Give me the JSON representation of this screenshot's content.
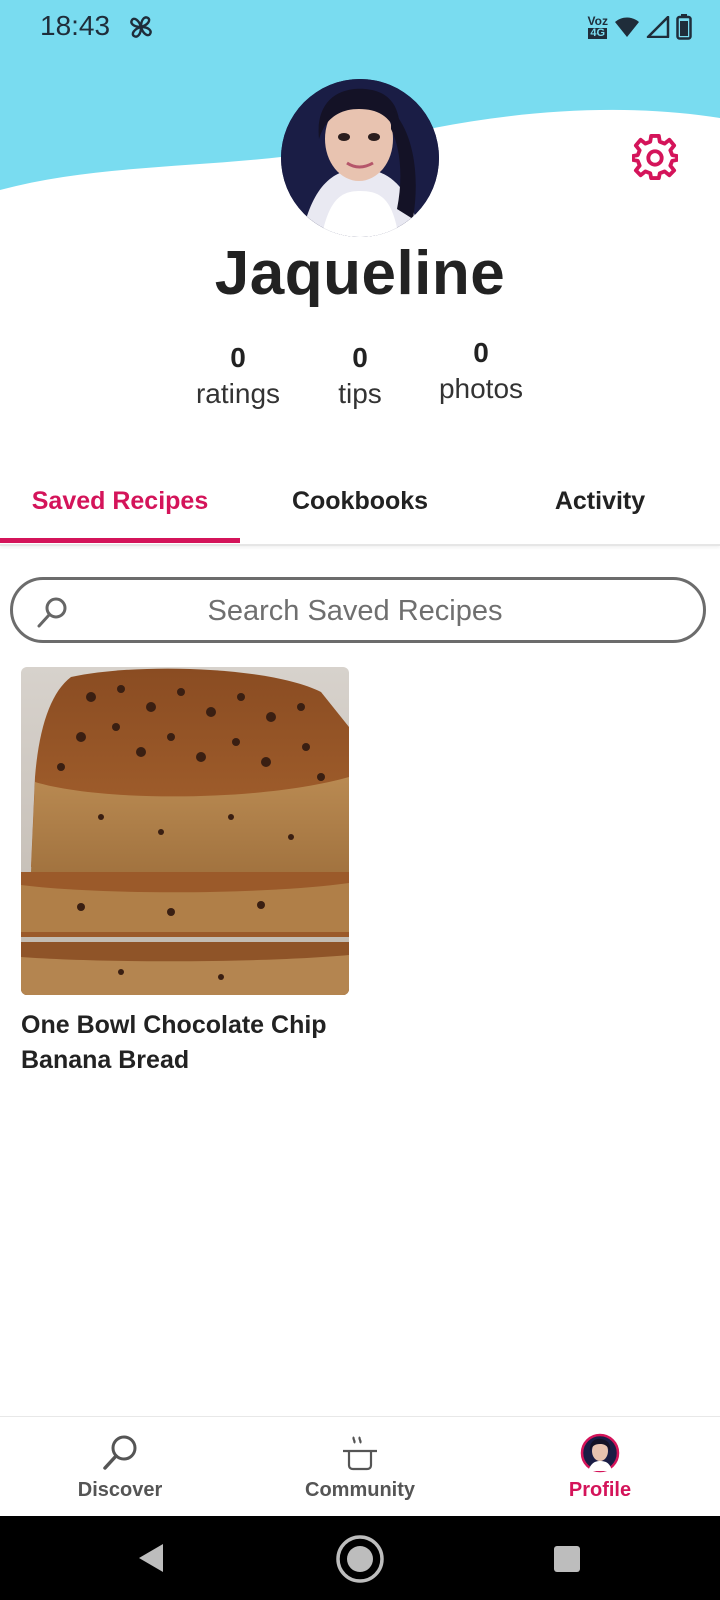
{
  "status_bar": {
    "time": "18:43",
    "network_label_top": "Voz",
    "network_label_bottom": "4G",
    "icons": [
      "fan-icon",
      "wifi-icon",
      "signal-icon",
      "battery-icon"
    ]
  },
  "colors": {
    "accent": "#d4145a",
    "header_wave": "#79dcf0",
    "system_nav": "#000000"
  },
  "profile": {
    "name": "Jaqueline",
    "settings_icon": "gear-icon",
    "stats": [
      {
        "value": "0",
        "label": "ratings"
      },
      {
        "value": "0",
        "label": "tips"
      },
      {
        "value": "0",
        "label": "photos"
      }
    ]
  },
  "tabs": [
    {
      "label": "Saved Recipes",
      "active": true
    },
    {
      "label": "Cookbooks",
      "active": false
    },
    {
      "label": "Activity",
      "active": false
    }
  ],
  "search": {
    "placeholder": "Search Saved Recipes",
    "value": ""
  },
  "saved_recipes": [
    {
      "title": "One Bowl Chocolate Chip Banana Bread"
    }
  ],
  "bottom_nav": [
    {
      "label": "Discover",
      "icon": "search-icon",
      "active": false
    },
    {
      "label": "Community",
      "icon": "pot-icon",
      "active": false
    },
    {
      "label": "Profile",
      "icon": "avatar-icon",
      "active": true
    }
  ],
  "system_nav": [
    "back-icon",
    "home-icon",
    "recents-icon"
  ]
}
